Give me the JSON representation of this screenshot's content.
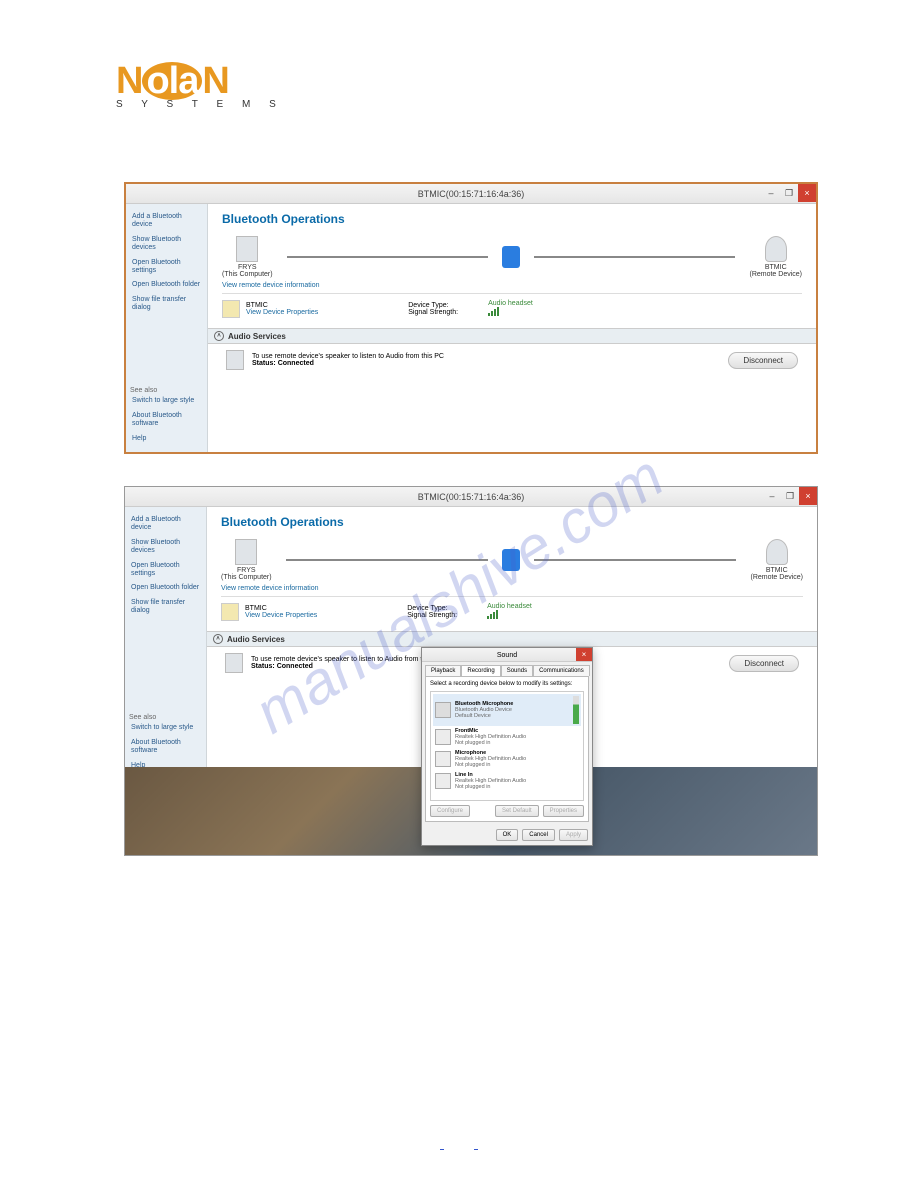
{
  "logo": {
    "part1": "N",
    "part2": "ola",
    "part3": "N",
    "subtitle": "S Y S T E M S"
  },
  "window_title": "BTMIC(00:15:71:16:4a:36)",
  "sidebar": {
    "items": [
      "Add a Bluetooth device",
      "Show Bluetooth devices",
      "Open Bluetooth settings",
      "Open Bluetooth folder",
      "Show file transfer dialog"
    ],
    "see_also_label": "See also",
    "see_also": [
      "Switch to large style",
      "About Bluetooth software",
      "Help"
    ]
  },
  "main": {
    "title": "Bluetooth Operations",
    "this_pc": {
      "name": "FRYS",
      "sub": "(This Computer)",
      "link": "View remote device information"
    },
    "remote": {
      "name": "BTMIC",
      "sub": "(Remote Device)"
    },
    "detail": {
      "name": "BTMIC",
      "link": "View Device Properties",
      "type_label": "Device Type:",
      "type_value": "Audio headset",
      "sig_label": "Signal Strength:"
    },
    "audio_header": "Audio Services",
    "service": {
      "desc": "To use remote device's speaker to listen to Audio from this PC",
      "status_label": "Status:",
      "status_value": "Connected",
      "button": "Disconnect"
    }
  },
  "sound_dialog": {
    "title": "Sound",
    "tabs": [
      "Playback",
      "Recording",
      "Sounds",
      "Communications"
    ],
    "active_tab": 1,
    "instruction": "Select a recording device below to modify its settings:",
    "devices": [
      {
        "name": "Bluetooth Microphone",
        "line2": "Bluetooth Audio Device",
        "line3": "Default Device",
        "selected": true,
        "active": true
      },
      {
        "name": "FrontMic",
        "line2": "Realtek High Definition Audio",
        "line3": "Not plugged in",
        "selected": false,
        "active": false
      },
      {
        "name": "Microphone",
        "line2": "Realtek High Definition Audio",
        "line3": "Not plugged in",
        "selected": false,
        "active": false
      },
      {
        "name": "Line In",
        "line2": "Realtek High Definition Audio",
        "line3": "Not plugged in",
        "selected": false,
        "active": false
      }
    ],
    "buttons": {
      "configure": "Configure",
      "set_default": "Set Default",
      "properties": "Properties",
      "ok": "OK",
      "cancel": "Cancel",
      "apply": "Apply"
    }
  },
  "watermark": "manualshive.com",
  "footer": {
    "left": " ",
    "right": " "
  }
}
